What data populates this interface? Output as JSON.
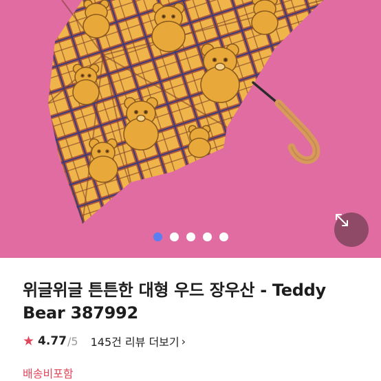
{
  "product": {
    "image_alt": "teddy bear plaid umbrella",
    "carousel": {
      "total": 5,
      "active": 1
    },
    "title_line1": "위글위글 튼튼한 대형 우드 장우산 - Teddy",
    "title_line2": "Bear 387992",
    "rating": {
      "score": "4.77",
      "out_of": "/5",
      "reviews_text": "145건 리뷰 더보기",
      "chevron": "›"
    },
    "shipping_text": "배송비포함"
  },
  "colors": {
    "background_pink": "#e06ca2",
    "umbrella_yellow": "#f0b54a",
    "plaid_brown": "#7a3f2a",
    "accent_red": "#e0475a",
    "dot_active": "#5b7ff0"
  },
  "icons": {
    "expand": "expand-arrows-icon",
    "star": "star-icon"
  }
}
